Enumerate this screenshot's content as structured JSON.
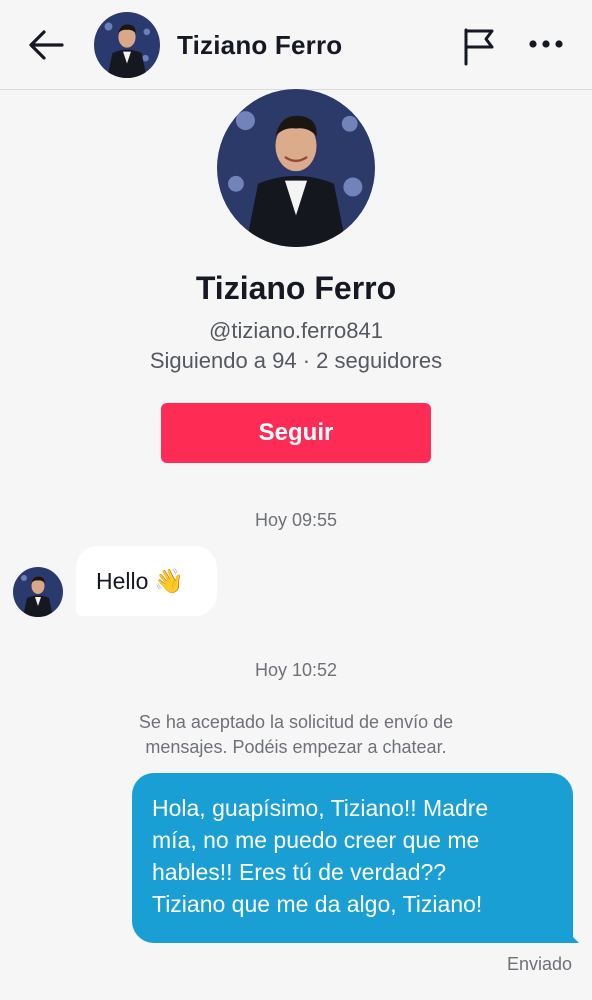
{
  "header": {
    "title": "Tiziano Ferro",
    "back_icon": "arrow-left-icon",
    "flag_icon": "flag-icon",
    "more_icon": "more-horizontal-icon"
  },
  "profile": {
    "name": "Tiziano Ferro",
    "handle": "@tiziano.ferro841",
    "stats": "Siguiendo a 94 · 2 seguidores",
    "follow_label": "Seguir"
  },
  "chat": {
    "timestamp_1": "Hoy 09:55",
    "incoming_text": "Hello",
    "incoming_emoji": "👋",
    "timestamp_2": "Hoy 10:52",
    "system_note_line1": "Se ha aceptado la solicitud de envío de",
    "system_note_line2": "mensajes. Podéis empezar a chatear.",
    "outgoing_line1": "Hola, guapísimo, Tiziano!! Madre",
    "outgoing_line2": "mía, no me puedo creer que me",
    "outgoing_line3": "hables!! Eres tú de verdad??",
    "outgoing_line4": "Tiziano que me da algo, Tiziano!",
    "status": "Enviado"
  },
  "colors": {
    "accent": "#fe2c55",
    "outgoing_bubble": "#1a9fd4",
    "background": "#f6f6f6"
  }
}
